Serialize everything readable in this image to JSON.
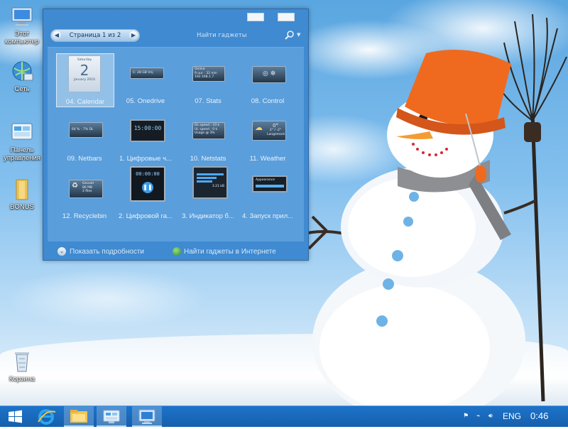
{
  "desktop": {
    "icons": [
      {
        "label": "Этот компьютер",
        "icon": "computer-icon"
      },
      {
        "label": "Сеть",
        "icon": "network-icon"
      },
      {
        "label": "Панель управления",
        "icon": "control-panel-icon"
      },
      {
        "label": "BONUS",
        "icon": "folder-icon"
      },
      {
        "label": "Корзина",
        "icon": "recycle-bin-icon"
      }
    ]
  },
  "gadget_window": {
    "page_indicator": "Страница 1 из 2",
    "search_placeholder": "Найти гаджеты",
    "gadgets": [
      {
        "label": "04. Calendar",
        "preview": [
          "Saturday",
          "2",
          "January 2010"
        ]
      },
      {
        "label": "05. Onedrive",
        "preview": [
          "C: 28 GB Vrij"
        ]
      },
      {
        "label": "07. Stats",
        "preview": [
          "Online",
          "9 uur : 32 min",
          "192.168.1.7"
        ]
      },
      {
        "label": "08. Control",
        "preview": []
      },
      {
        "label": "09. Netbars",
        "preview": [
          "64 % - 7% DL"
        ]
      },
      {
        "label": "1. Цифровые ч...",
        "preview": [
          "15:00:00"
        ]
      },
      {
        "label": "10. Netstats",
        "preview": [
          "DL speed : 33 k",
          "UL speed : 0 k",
          "Usage @ 3%"
        ]
      },
      {
        "label": "11. Weather",
        "preview": [
          "0°",
          "2° / -2°",
          "Langemark"
        ]
      },
      {
        "label": "12. Recyclebin",
        "preview": [
          "Gevuld",
          "86 MB",
          "2 files"
        ]
      },
      {
        "label": "2. Цифровой га...",
        "preview": [
          "00:00:00"
        ]
      },
      {
        "label": "3. Индикатор б...",
        "preview": [
          "3.21 kB"
        ]
      },
      {
        "label": "4. Запуск прил...",
        "preview": [
          "Appearance"
        ]
      }
    ],
    "show_details": "Показать подробности",
    "online_link": "Найти гаджеты в Интернете"
  },
  "taskbar": {
    "language": "ENG",
    "time": "0:46",
    "buttons": [
      "start-icon",
      "ie-icon",
      "explorer-icon",
      "control-panel-icon",
      "desktop-gadgets-icon"
    ]
  },
  "colors": {
    "window": "#3f8ad1",
    "gallery": "#5a9edb",
    "taskbar": "#1a6bbf"
  }
}
